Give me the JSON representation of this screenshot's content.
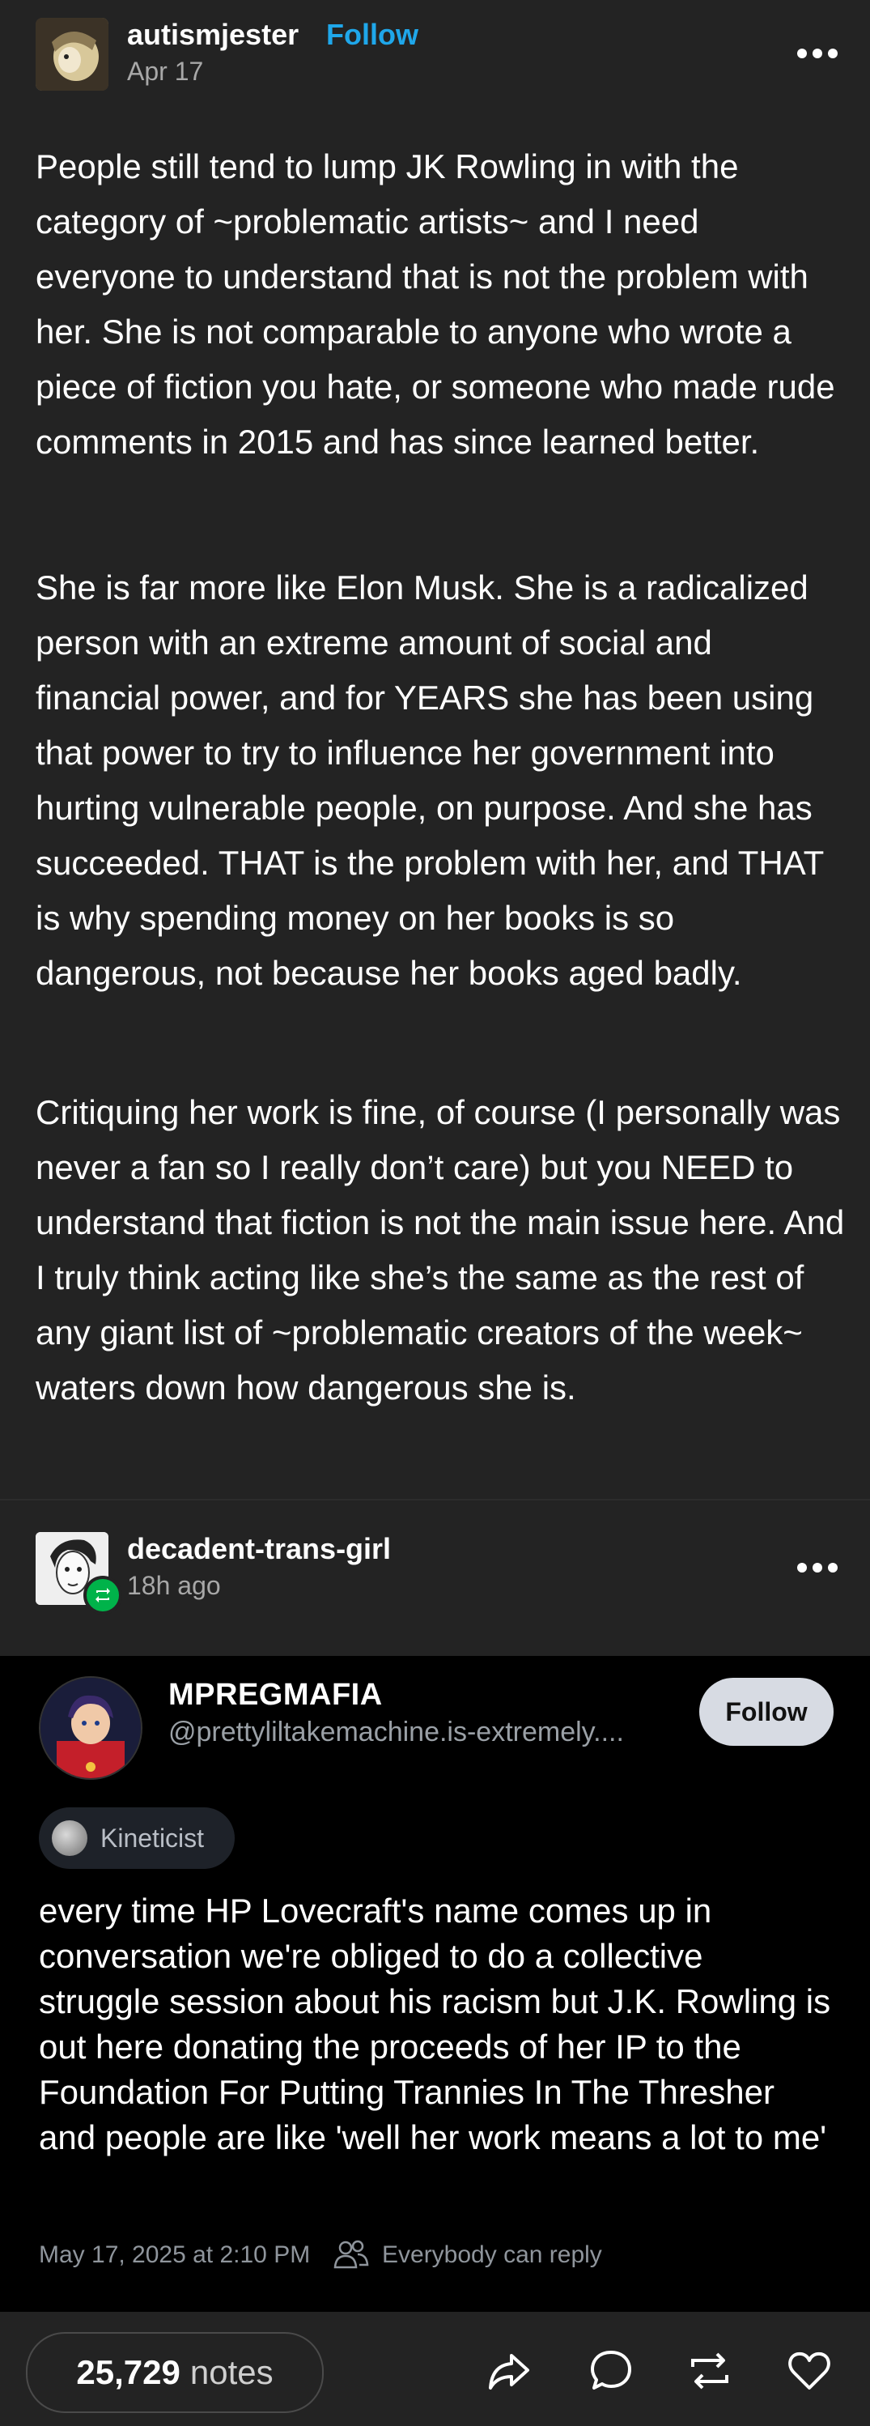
{
  "post": {
    "username": "autismjester",
    "follow_label": "Follow",
    "date": "Apr 17",
    "paragraphs": [
      "People still tend to lump JK Rowling in with the category of ~problematic artists~ and I need everyone to understand that is not the problem with her. She is not comparable to anyone who wrote a piece of fiction you hate, or someone who made rude comments in 2015 and has since learned better.",
      "She is far more like Elon Musk. She is a radicalized person with an extreme amount of social and financial power, and for YEARS she has been using that power to try to influence her government into hurting vulnerable people, on purpose. And she has succeeded. THAT is the problem with her, and THAT is why spending money on her books is so dangerous, not because her books aged badly.",
      "Critiquing her work is fine, of course (I personally was never a fan so I really don’t care) but you NEED to understand that fiction is not the main issue here. And I truly think acting like she’s the same as the rest of any giant list of ~problematic creators of the week~ waters down how dangerous she is."
    ]
  },
  "reblog": {
    "username": "decadent-trans-girl",
    "time": "18h ago"
  },
  "embed": {
    "display_name": "MPREGMAFIA",
    "handle": "@prettyliltakemachine.is-extremely....",
    "follow_label": "Follow",
    "pill_label": "Kineticist",
    "text": "every time HP Lovecraft's name comes up in conversation we're obliged to do a collective struggle session about his racism but J.K. Rowling is out here donating the proceeds of her IP to the Foundation For Putting Trannies In The Thresher and people are like 'well her work means a lot to me'",
    "timestamp": "May 17, 2025 at 2:10 PM",
    "reply_setting": "Everybody can reply"
  },
  "footer": {
    "notes_count": "25,729",
    "notes_label": "notes",
    "icons": [
      "share-icon",
      "reply-icon",
      "reblog-icon",
      "like-icon"
    ]
  },
  "colors": {
    "background": "#232323",
    "embed_background": "#000000",
    "accent_blue": "#1fa7ea",
    "reblog_green": "#00b34a"
  }
}
